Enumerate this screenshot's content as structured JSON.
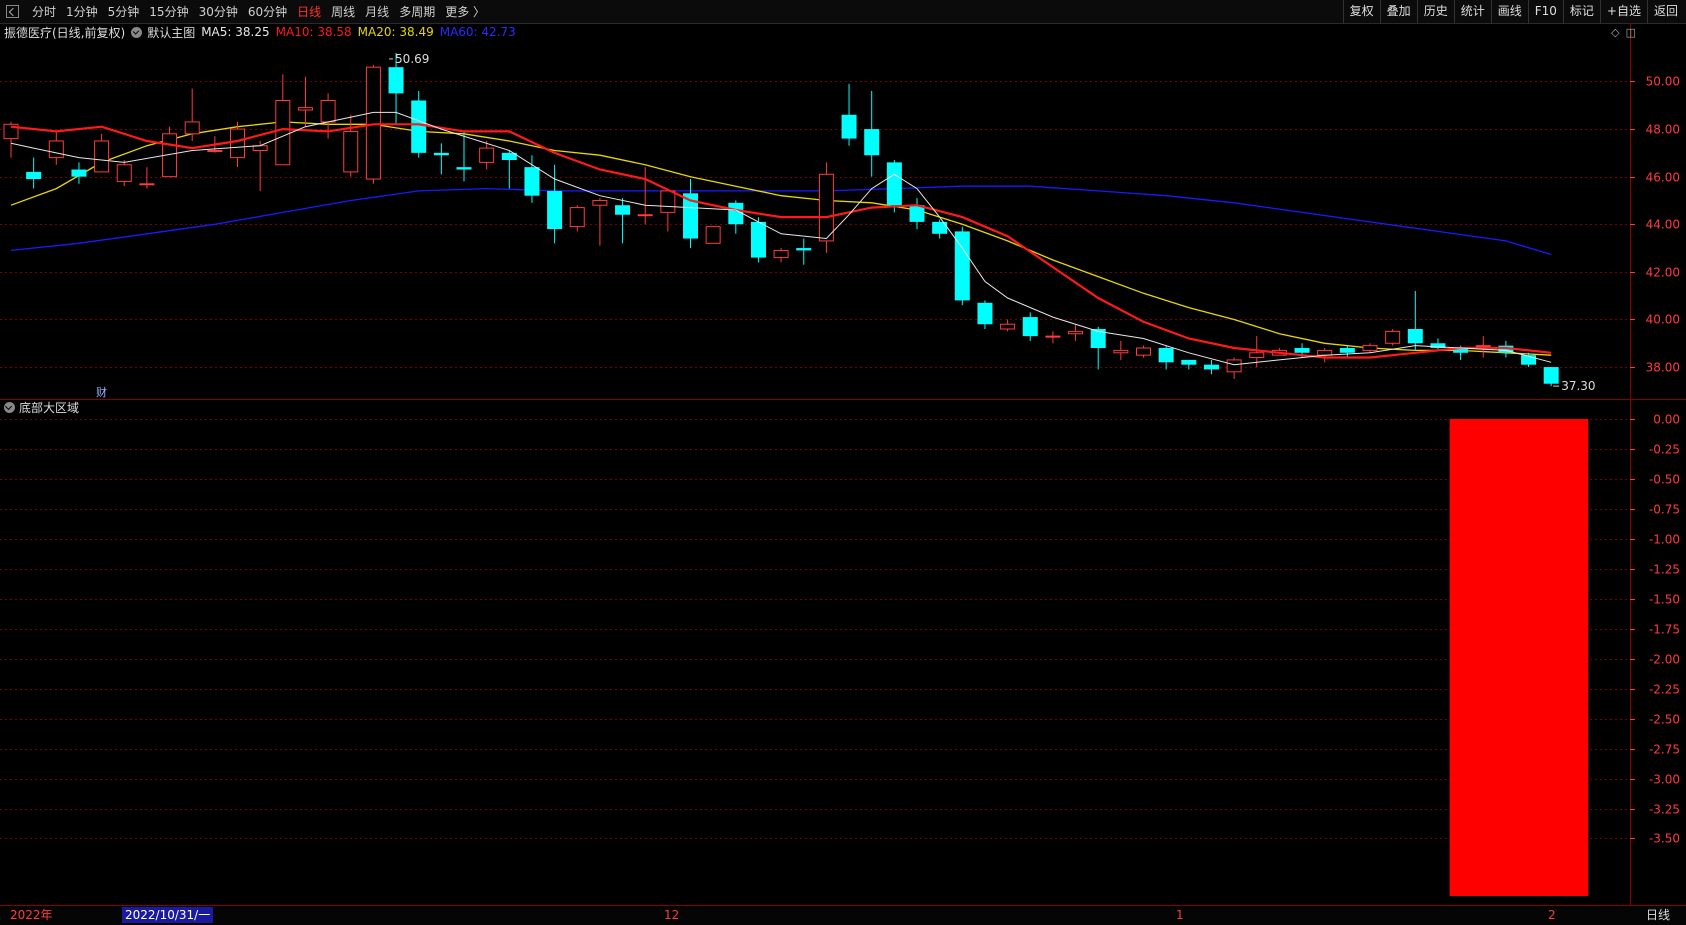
{
  "toolbar": {
    "tabs": [
      "分时",
      "1分钟",
      "5分钟",
      "15分钟",
      "30分钟",
      "60分钟",
      "日线",
      "周线",
      "月线",
      "多周期",
      "更多 〉"
    ],
    "active_tab": "日线",
    "right_tools": [
      "复权",
      "叠加",
      "历史",
      "统计",
      "画线",
      "F10",
      "标记",
      "+自选",
      "返回"
    ]
  },
  "legend": {
    "stock": "振德医疗(日线,前复权)",
    "main_indicator": "默认主图",
    "ma5": "MA5: 38.25",
    "ma10": "MA10: 38.58",
    "ma20": "MA20: 38.49",
    "ma60": "MA60: 42.73"
  },
  "colors": {
    "up": "#ff3b3b",
    "down": "#00ffff",
    "ma5": "#e8e8e8",
    "ma10": "#ff1a1a",
    "ma20": "#e6d800",
    "ma60": "#1a1aff",
    "grid": "#7a0000",
    "axis": "#ff3b3b"
  },
  "fin_tag": "财",
  "annotations": {
    "high": "50.69",
    "low": "37.30"
  },
  "sub_panel": {
    "title": "底部大区域"
  },
  "bottom": {
    "year": "2022年",
    "date": "2022/10/31/一",
    "mark_12": "12",
    "mark_1": "1",
    "mark_2": "2",
    "period": "日线"
  },
  "chart_data": [
    {
      "type": "candlestick",
      "title": "振德医疗(日线,前复权)",
      "y_ticks": [
        "50.00",
        "48.00",
        "46.00",
        "44.00",
        "42.00",
        "40.00",
        "38.00"
      ],
      "ylim": [
        36.7,
        51.7
      ],
      "candles": [
        [
          47.6,
          48.2,
          46.8,
          48.3
        ],
        [
          46.2,
          45.9,
          45.5,
          46.8
        ],
        [
          46.8,
          47.5,
          46.5,
          47.9
        ],
        [
          46.3,
          46.0,
          45.7,
          46.6
        ],
        [
          46.2,
          47.5,
          46.3,
          47.8
        ],
        [
          45.8,
          46.5,
          45.6,
          46.7
        ],
        [
          45.7,
          45.7,
          45.5,
          46.4
        ],
        [
          46.0,
          47.8,
          46.0,
          48.1
        ],
        [
          47.8,
          48.3,
          47.5,
          49.7
        ],
        [
          47.1,
          47.1,
          47.0,
          47.7
        ],
        [
          46.8,
          48.0,
          46.4,
          48.3
        ],
        [
          47.1,
          47.3,
          45.4,
          47.5
        ],
        [
          46.5,
          49.2,
          46.5,
          50.3
        ],
        [
          48.8,
          48.9,
          48.1,
          50.2
        ],
        [
          48.3,
          49.2,
          47.6,
          49.5
        ],
        [
          46.2,
          47.9,
          46.0,
          48.6
        ],
        [
          45.9,
          50.6,
          45.7,
          50.7
        ],
        [
          50.6,
          49.5,
          48.2,
          51.2
        ],
        [
          49.2,
          47.0,
          46.8,
          49.6
        ],
        [
          47.0,
          46.9,
          46.1,
          47.4
        ],
        [
          46.4,
          46.3,
          45.8,
          47.9
        ],
        [
          46.6,
          47.2,
          46.3,
          47.5
        ],
        [
          47.0,
          46.7,
          45.5,
          47.1
        ],
        [
          46.4,
          45.2,
          44.9,
          46.9
        ],
        [
          45.4,
          43.8,
          43.2,
          46.5
        ],
        [
          43.9,
          44.7,
          43.7,
          44.8
        ],
        [
          44.8,
          45.0,
          43.1,
          45.1
        ],
        [
          44.8,
          44.4,
          43.2,
          45.1
        ],
        [
          44.4,
          44.4,
          44.0,
          46.4
        ],
        [
          44.5,
          45.4,
          43.7,
          45.5
        ],
        [
          45.3,
          43.4,
          43.0,
          45.9
        ],
        [
          43.2,
          43.9,
          43.3,
          43.9
        ],
        [
          44.9,
          44.0,
          43.6,
          45.0
        ],
        [
          44.1,
          42.6,
          42.4,
          44.3
        ],
        [
          42.6,
          42.9,
          42.4,
          43.0
        ],
        [
          43.0,
          42.9,
          42.3,
          43.4
        ],
        [
          43.3,
          46.1,
          42.8,
          46.6
        ],
        [
          48.6,
          47.6,
          47.3,
          49.9
        ],
        [
          48.0,
          46.9,
          46.0,
          49.6
        ],
        [
          46.6,
          44.8,
          44.5,
          46.7
        ],
        [
          44.8,
          44.1,
          43.8,
          45.1
        ],
        [
          44.1,
          43.6,
          43.4,
          44.2
        ],
        [
          43.7,
          40.8,
          40.6,
          43.9
        ],
        [
          40.7,
          39.8,
          39.6,
          40.8
        ],
        [
          39.6,
          39.8,
          39.5,
          40.0
        ],
        [
          40.1,
          39.3,
          39.1,
          40.3
        ],
        [
          39.3,
          39.3,
          39.0,
          39.5
        ],
        [
          39.4,
          39.5,
          39.1,
          39.8
        ],
        [
          39.6,
          38.8,
          37.9,
          39.7
        ],
        [
          38.6,
          38.7,
          38.3,
          39.1
        ],
        [
          38.5,
          38.8,
          38.4,
          38.9
        ],
        [
          38.8,
          38.2,
          37.9,
          38.9
        ],
        [
          38.3,
          38.1,
          37.9,
          38.3
        ],
        [
          38.1,
          37.9,
          37.7,
          38.3
        ],
        [
          37.8,
          38.3,
          37.5,
          38.4
        ],
        [
          38.4,
          38.6,
          38.0,
          39.3
        ],
        [
          38.5,
          38.7,
          38.5,
          38.8
        ],
        [
          38.8,
          38.6,
          38.4,
          39.0
        ],
        [
          38.5,
          38.7,
          38.2,
          38.8
        ],
        [
          38.8,
          38.6,
          38.4,
          38.9
        ],
        [
          38.7,
          38.9,
          38.6,
          39.0
        ],
        [
          39.0,
          39.5,
          38.9,
          39.6
        ],
        [
          39.6,
          39.0,
          38.7,
          41.2
        ],
        [
          39.0,
          38.8,
          38.7,
          39.2
        ],
        [
          38.8,
          38.6,
          38.3,
          38.9
        ],
        [
          38.9,
          38.9,
          38.4,
          39.3
        ],
        [
          38.9,
          38.6,
          38.4,
          39.1
        ],
        [
          38.5,
          38.1,
          38.0,
          38.6
        ],
        [
          38.0,
          37.3,
          37.2,
          38.0
        ]
      ],
      "ma5": [
        [
          0,
          47.4
        ],
        [
          1,
          47.2
        ],
        [
          3,
          46.8
        ],
        [
          5,
          46.6
        ],
        [
          8,
          47.1
        ],
        [
          11,
          47.3
        ],
        [
          13,
          48.1
        ],
        [
          16,
          48.7
        ],
        [
          17,
          48.7
        ],
        [
          19,
          48.0
        ],
        [
          22,
          47.1
        ],
        [
          24,
          45.9
        ],
        [
          26,
          45.2
        ],
        [
          28,
          44.8
        ],
        [
          32,
          44.6
        ],
        [
          34,
          43.6
        ],
        [
          36,
          43.4
        ],
        [
          37,
          44.4
        ],
        [
          38,
          45.5
        ],
        [
          39,
          46.1
        ],
        [
          40,
          45.5
        ],
        [
          41,
          44.3
        ],
        [
          42,
          43.0
        ],
        [
          43,
          41.6
        ],
        [
          44,
          40.9
        ],
        [
          46,
          40.1
        ],
        [
          48,
          39.5
        ],
        [
          50,
          39.2
        ],
        [
          52,
          38.6
        ],
        [
          54,
          38.1
        ],
        [
          56,
          38.3
        ],
        [
          58,
          38.5
        ],
        [
          60,
          38.6
        ],
        [
          62,
          38.9
        ],
        [
          64,
          38.8
        ],
        [
          66,
          38.7
        ],
        [
          68,
          38.2
        ]
      ],
      "ma10": [
        [
          0,
          48.1
        ],
        [
          2,
          47.9
        ],
        [
          4,
          48.1
        ],
        [
          6,
          47.5
        ],
        [
          8,
          47.2
        ],
        [
          10,
          47.5
        ],
        [
          12,
          48.0
        ],
        [
          14,
          47.9
        ],
        [
          16,
          48.2
        ],
        [
          18,
          48.2
        ],
        [
          20,
          47.9
        ],
        [
          22,
          47.9
        ],
        [
          24,
          47.0
        ],
        [
          26,
          46.3
        ],
        [
          28,
          45.9
        ],
        [
          30,
          45.0
        ],
        [
          32,
          44.6
        ],
        [
          34,
          44.3
        ],
        [
          36,
          44.3
        ],
        [
          38,
          44.7
        ],
        [
          40,
          44.8
        ],
        [
          42,
          44.3
        ],
        [
          44,
          43.5
        ],
        [
          46,
          42.2
        ],
        [
          48,
          40.9
        ],
        [
          50,
          39.9
        ],
        [
          52,
          39.2
        ],
        [
          54,
          38.8
        ],
        [
          56,
          38.6
        ],
        [
          58,
          38.4
        ],
        [
          60,
          38.4
        ],
        [
          62,
          38.6
        ],
        [
          64,
          38.8
        ],
        [
          66,
          38.8
        ],
        [
          68,
          38.6
        ]
      ],
      "ma20": [
        [
          0,
          44.8
        ],
        [
          2,
          45.5
        ],
        [
          4,
          46.6
        ],
        [
          6,
          47.3
        ],
        [
          8,
          47.8
        ],
        [
          10,
          48.1
        ],
        [
          12,
          48.3
        ],
        [
          14,
          48.2
        ],
        [
          16,
          48.2
        ],
        [
          18,
          47.9
        ],
        [
          20,
          47.8
        ],
        [
          22,
          47.5
        ],
        [
          24,
          47.1
        ],
        [
          26,
          46.9
        ],
        [
          28,
          46.5
        ],
        [
          30,
          46.0
        ],
        [
          32,
          45.6
        ],
        [
          34,
          45.2
        ],
        [
          36,
          45.0
        ],
        [
          38,
          44.9
        ],
        [
          40,
          44.6
        ],
        [
          42,
          44.0
        ],
        [
          44,
          43.3
        ],
        [
          46,
          42.5
        ],
        [
          48,
          41.8
        ],
        [
          50,
          41.1
        ],
        [
          52,
          40.5
        ],
        [
          54,
          40.0
        ],
        [
          56,
          39.4
        ],
        [
          58,
          39.0
        ],
        [
          60,
          38.8
        ],
        [
          62,
          38.7
        ],
        [
          64,
          38.7
        ],
        [
          66,
          38.6
        ],
        [
          68,
          38.5
        ]
      ],
      "ma60": [
        [
          0,
          42.9
        ],
        [
          3,
          43.2
        ],
        [
          6,
          43.6
        ],
        [
          9,
          44.0
        ],
        [
          12,
          44.5
        ],
        [
          15,
          45.0
        ],
        [
          18,
          45.4
        ],
        [
          21,
          45.5
        ],
        [
          24,
          45.4
        ],
        [
          27,
          45.4
        ],
        [
          30,
          45.4
        ],
        [
          33,
          45.4
        ],
        [
          36,
          45.4
        ],
        [
          39,
          45.5
        ],
        [
          42,
          45.6
        ],
        [
          45,
          45.6
        ],
        [
          48,
          45.4
        ],
        [
          51,
          45.2
        ],
        [
          54,
          44.9
        ],
        [
          57,
          44.5
        ],
        [
          60,
          44.1
        ],
        [
          63,
          43.7
        ],
        [
          66,
          43.3
        ],
        [
          68,
          42.73
        ]
      ]
    },
    {
      "type": "bar",
      "title": "底部大区域",
      "y_ticks": [
        "0.00",
        "-0.25",
        "-0.50",
        "-0.75",
        "-1.00",
        "-1.25",
        "-1.50",
        "-1.75",
        "-2.00",
        "-2.25",
        "-2.50",
        "-2.75",
        "-3.00",
        "-3.25",
        "-3.50"
      ],
      "ylim": [
        -3.98,
        0.0
      ],
      "bar": {
        "from_candle": 64,
        "to_candle": 68,
        "value": -3.98
      }
    }
  ]
}
